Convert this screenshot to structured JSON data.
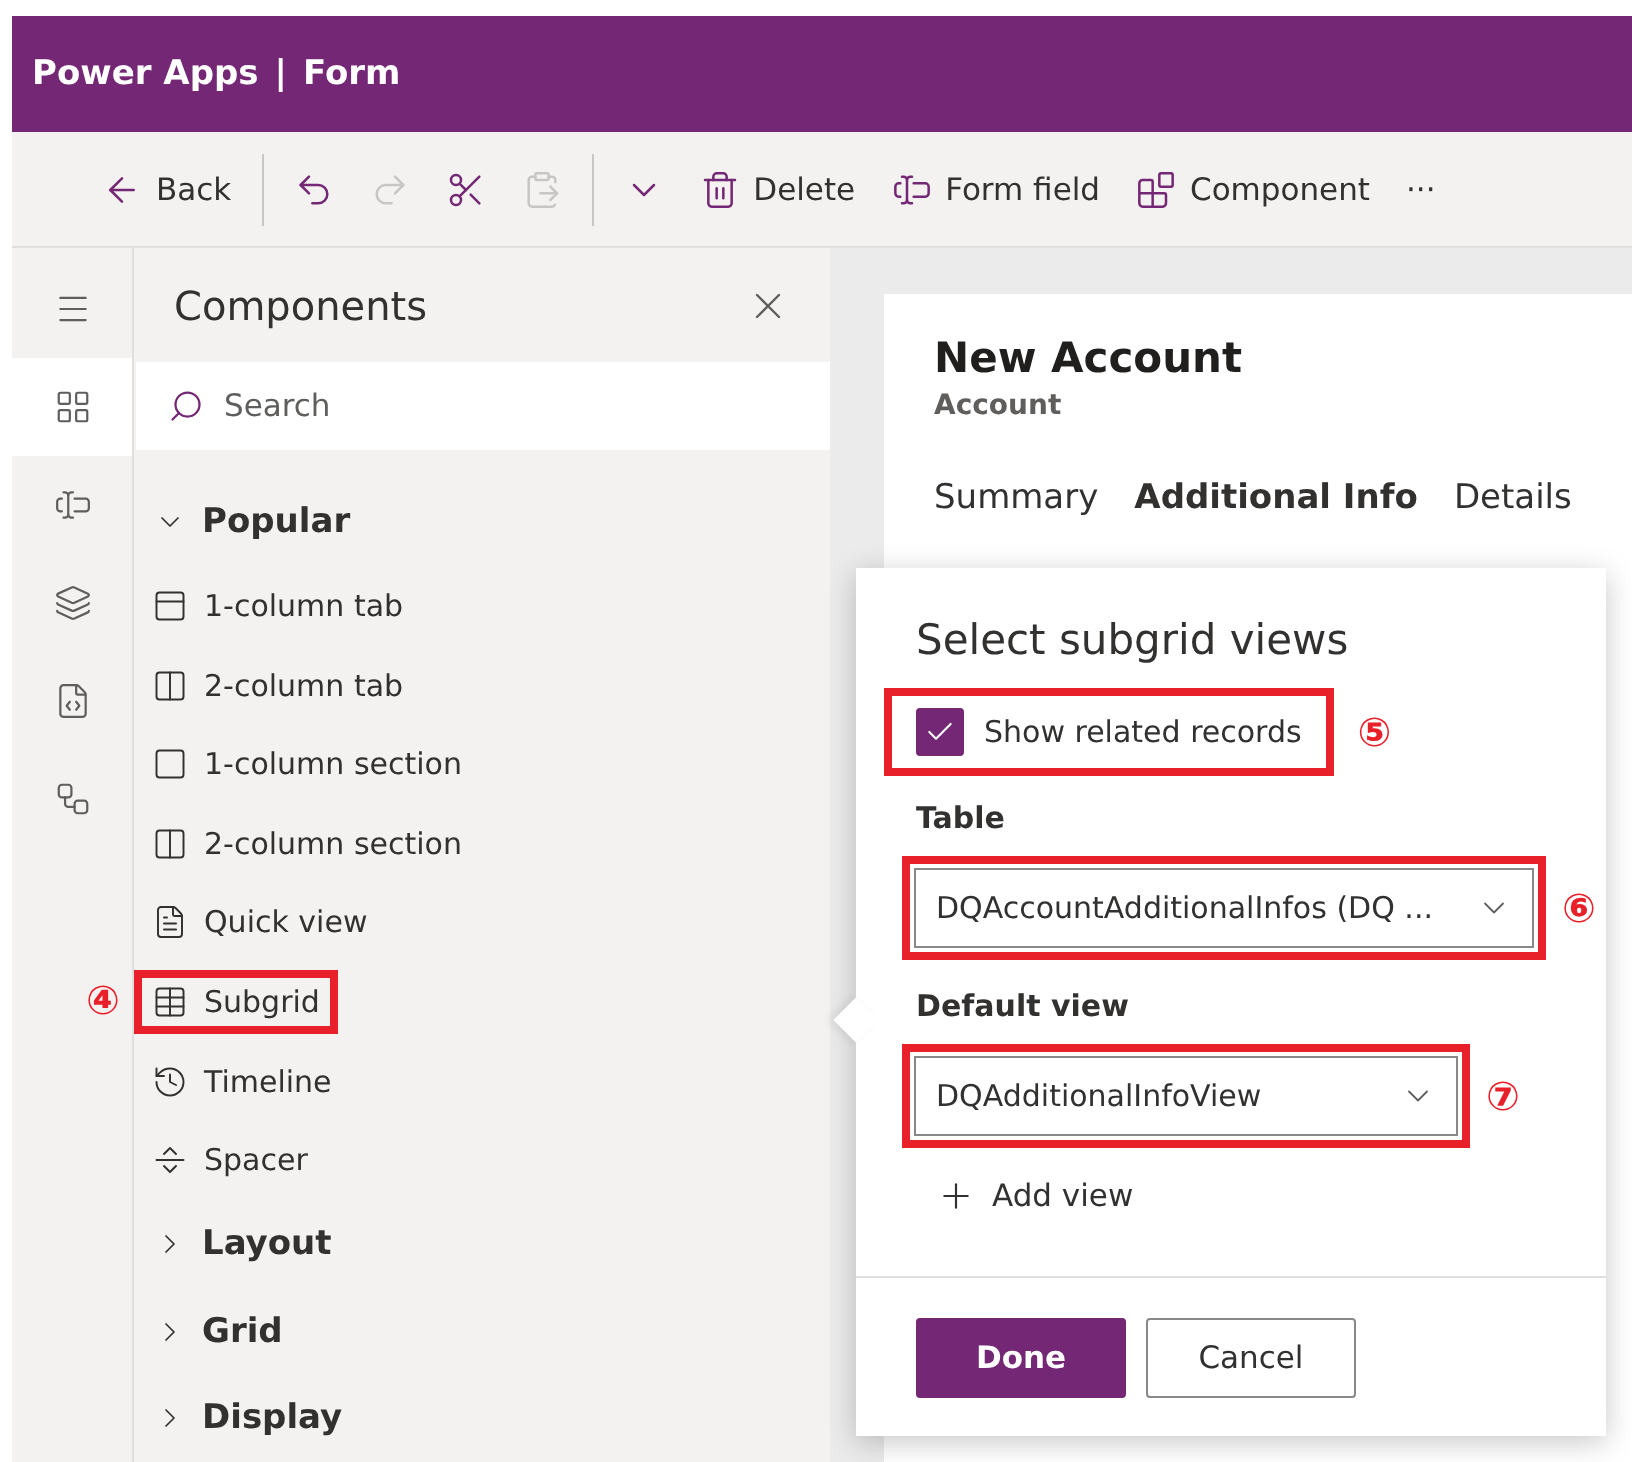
{
  "header": {
    "app": "Power Apps",
    "separator": "|",
    "page": "Form"
  },
  "toolbar": [
    {
      "kind": "back",
      "label": "Back",
      "disabled": false
    },
    {
      "kind": "divider"
    },
    {
      "kind": "undo",
      "disabled": false
    },
    {
      "kind": "redo",
      "disabled": true
    },
    {
      "kind": "cut",
      "disabled": false
    },
    {
      "kind": "paste",
      "disabled": true
    },
    {
      "kind": "divider"
    },
    {
      "kind": "dropdown",
      "disabled": false
    },
    {
      "kind": "delete",
      "label": "Delete",
      "disabled": false
    },
    {
      "kind": "form-field",
      "label": "Form field",
      "disabled": false
    },
    {
      "kind": "component",
      "label": "Component",
      "disabled": false
    },
    {
      "kind": "more",
      "label": "···",
      "disabled": false
    }
  ],
  "rail": [
    {
      "kind": "menu",
      "selected": false
    },
    {
      "kind": "components",
      "selected": true
    },
    {
      "kind": "fields",
      "selected": false
    },
    {
      "kind": "layers",
      "selected": false
    },
    {
      "kind": "scripts",
      "selected": false
    },
    {
      "kind": "tree",
      "selected": false
    }
  ],
  "components_panel": {
    "title": "Components",
    "search": {
      "placeholder": "Search"
    },
    "groups": [
      {
        "label": "Popular",
        "expanded": true,
        "items": [
          {
            "kind": "tab1",
            "label": "1-column tab",
            "highlighted": false
          },
          {
            "kind": "tab2",
            "label": "2-column tab",
            "highlighted": false
          },
          {
            "kind": "section1",
            "label": "1-column section",
            "highlighted": false
          },
          {
            "kind": "section2",
            "label": "2-column section",
            "highlighted": false
          },
          {
            "kind": "quickview",
            "label": "Quick view",
            "highlighted": false
          },
          {
            "kind": "subgrid",
            "label": "Subgrid",
            "highlighted": true,
            "callout": "④"
          },
          {
            "kind": "timeline",
            "label": "Timeline",
            "highlighted": false
          },
          {
            "kind": "spacer",
            "label": "Spacer",
            "highlighted": false
          }
        ]
      },
      {
        "label": "Layout",
        "expanded": false
      },
      {
        "label": "Grid",
        "expanded": false
      },
      {
        "label": "Display",
        "expanded": false
      }
    ]
  },
  "form": {
    "title": "New Account",
    "subtitle": "Account",
    "tabs": [
      {
        "label": "Summary",
        "selected": false
      },
      {
        "label": "Additional Info",
        "selected": true
      },
      {
        "label": "Details",
        "selected": false
      }
    ]
  },
  "dialog": {
    "title": "Select subgrid views",
    "show_related": {
      "label": "Show related records",
      "checked": true,
      "highlighted": true,
      "callout": "⑤"
    },
    "table": {
      "label": "Table",
      "value": "DQAccountAdditionalInfos (DQ ...",
      "highlighted": true,
      "callout": "⑥"
    },
    "default_view": {
      "label": "Default view",
      "value": "DQAdditionalInfoView",
      "highlighted": true,
      "callout": "⑦"
    },
    "add_view": {
      "label": "Add view"
    },
    "buttons": [
      {
        "kind": "primary",
        "label": "Done"
      },
      {
        "kind": "secondary",
        "label": "Cancel"
      }
    ]
  }
}
